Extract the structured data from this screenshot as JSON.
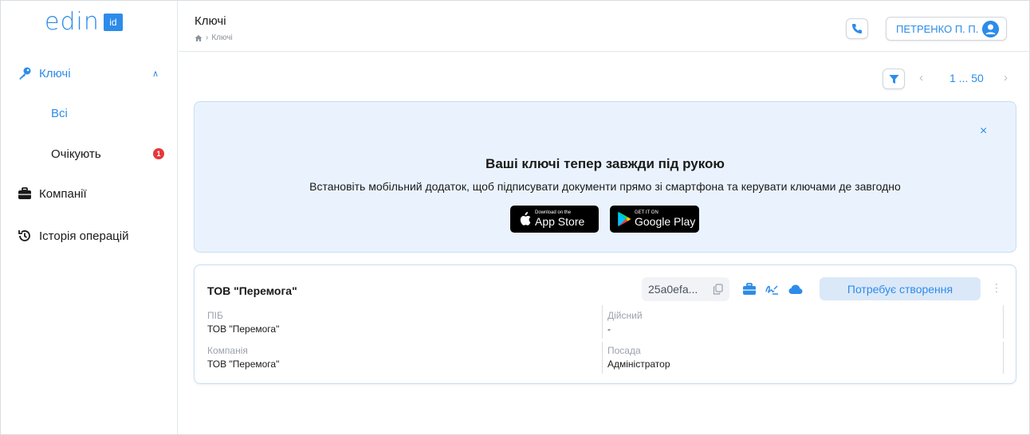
{
  "logo": {
    "text": "edin",
    "badge": "id"
  },
  "sidebar": {
    "keys_label": "Ключі",
    "all_label": "Всі",
    "waiting_label": "Очікують",
    "waiting_count": "1",
    "companies_label": "Компанії",
    "history_label": "Історія операцій"
  },
  "header": {
    "title": "Ключі",
    "breadcrumb_current": "Ключі",
    "user_name": "ПЕТРЕНКО П. П."
  },
  "pager": {
    "range": "1 ... 50",
    "prev": "‹",
    "next": "›"
  },
  "banner": {
    "close": "×",
    "title": "Ваші ключі тепер завжди під рукою",
    "text": "Встановіть мобільний додаток, щоб підписувати документи прямо зі смартфона та керувати ключами де завгодно",
    "appstore_small": "Download on the",
    "appstore_big": "App Store",
    "google_small": "GET IT ON",
    "google_big": "Google Play"
  },
  "key_card": {
    "title": "ТОВ \"Перемога\"",
    "hash": "25a0efa...",
    "status": "Потребує створення",
    "kebab": "⋮",
    "fields": {
      "pib_label": "ПІБ",
      "pib_value": "ТОВ \"Перемога\"",
      "valid_label": "Дійсний",
      "valid_value": "-",
      "company_label": "Компанія",
      "company_value": "ТОВ \"Перемога\"",
      "position_label": "Посада",
      "position_value": "Адміністратор"
    }
  },
  "colors": {
    "accent": "#2d8ce9",
    "banner_bg": "#eaf3fd",
    "badge": "#e5383b"
  }
}
